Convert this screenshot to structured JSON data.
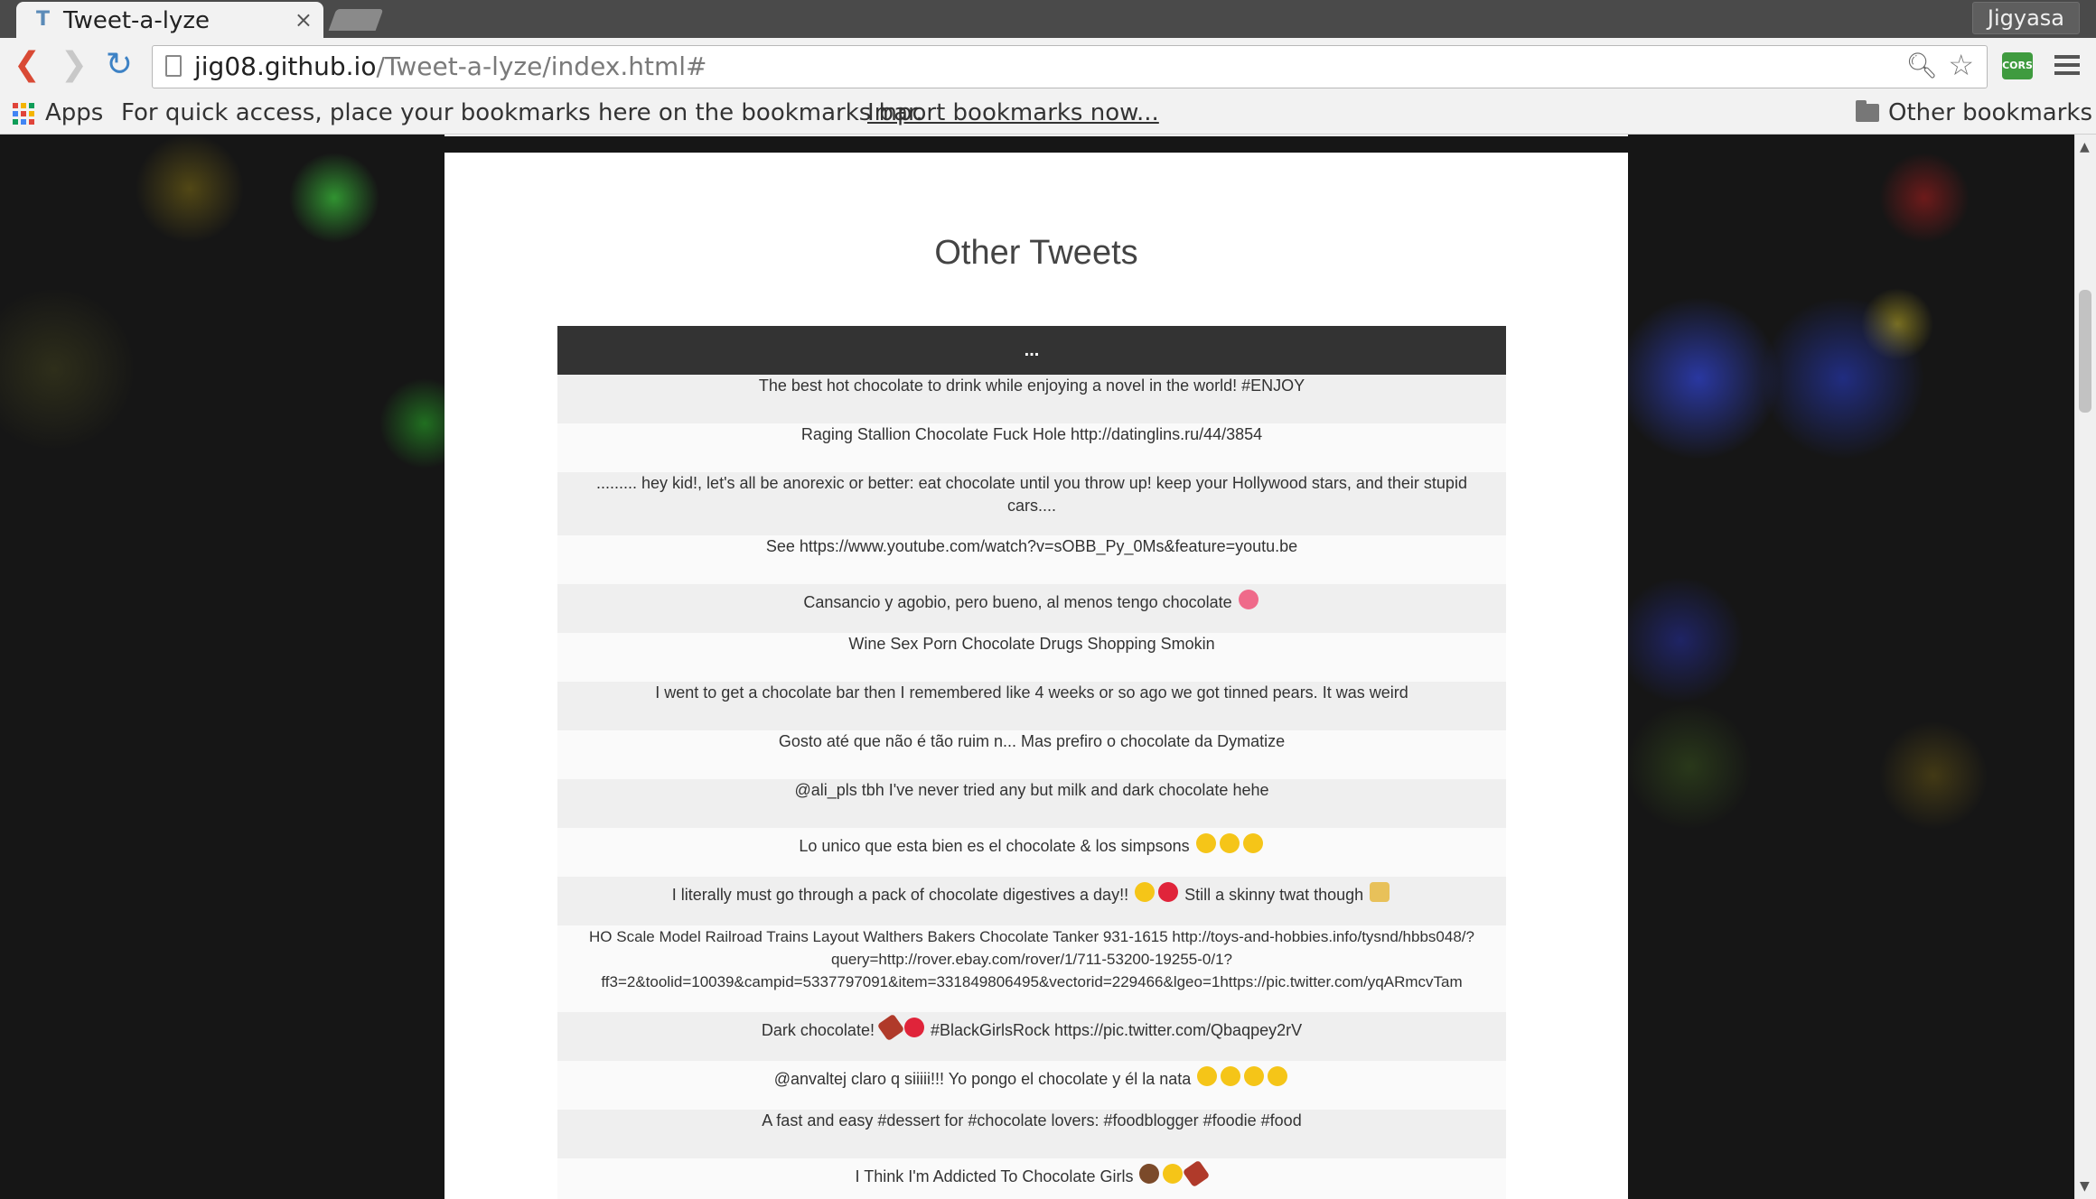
{
  "browser": {
    "tab_title": "Tweet-a-lyze",
    "tab_close": "×",
    "profile_name": "Jigyasa",
    "url_host": "jig08.github.io",
    "url_path": "/Tweet-a-lyze/index.html#",
    "extension_label": "CORS"
  },
  "bookmarks_bar": {
    "apps_label": "Apps",
    "hint": "For quick access, place your bookmarks here on the bookmarks bar.",
    "import_link": "Import bookmarks now...",
    "other_bookmarks": "Other bookmarks"
  },
  "page": {
    "heading": "Other Tweets",
    "table_header": "...",
    "tweets": [
      {
        "text": "The best hot chocolate to drink while enjoying a novel in the world! #ENJOY",
        "emoji": []
      },
      {
        "text": "Raging Stallion Chocolate Fuck Hole http://datinglins.ru/44/3854",
        "emoji": []
      },
      {
        "text": "......... hey kid!, let's all be anorexic or better: eat chocolate until you throw up! keep your Hollywood stars, and their stupid cars....",
        "emoji": []
      },
      {
        "text": "See https://www.youtube.com/watch?v=sOBB_Py_0Ms&feature=youtu.be",
        "emoji": []
      },
      {
        "text": "Cansancio y agobio, pero bueno, al menos tengo chocolate",
        "emoji": [
          "pink"
        ]
      },
      {
        "text": "Wine Sex Porn Chocolate Drugs Shopping Smokin",
        "emoji": []
      },
      {
        "text": "I went to get a chocolate bar then I remembered like 4 weeks or so ago we got tinned pears. It was weird",
        "emoji": []
      },
      {
        "text": "Gosto até que não é tão ruim n... Mas prefiro o chocolate da Dymatize",
        "emoji": []
      },
      {
        "text": "@ali_pls tbh I've never tried any but milk and dark chocolate hehe",
        "emoji": []
      },
      {
        "text": "Lo unico que esta bien es el chocolate & los simpsons",
        "emoji": [
          "yellow",
          "yellow",
          "yellow"
        ]
      },
      {
        "text": "I literally must go through a pack of chocolate digestives a day!!",
        "emoji": [
          "yellow",
          "red"
        ],
        "text_after": "Still a skinny twat though",
        "emoji_after": [
          "blonde"
        ]
      },
      {
        "text": "HO Scale Model Railroad Trains Layout Walthers Bakers Chocolate Tanker 931-1615 http://toys-and-hobbies.info/tysnd/hbbs048/?query=http://rover.ebay.com/rover/1/711-53200-19255-0/1?ff3=2&toolid=10039&campid=5337797091&item=331849806495&vectorid=229466&lgeo=1https://pic.twitter.com/yqARmcvTam",
        "emoji": []
      },
      {
        "text": "Dark chocolate!",
        "emoji": [
          "choc",
          "red"
        ],
        "text_after": "#BlackGirlsRock https://pic.twitter.com/Qbaqpey2rV",
        "emoji_after": []
      },
      {
        "text": "@anvaltej claro q siiiii!!! Yo pongo el chocolate y él la nata",
        "emoji": [
          "yellow",
          "yellow",
          "yellow",
          "yellow"
        ]
      },
      {
        "text": "A fast and easy #dessert for #chocolate lovers: #foodblogger #foodie #food",
        "emoji": []
      },
      {
        "text": "I Think I'm Addicted To Chocolate Girls",
        "emoji": [
          "brown",
          "yellow",
          "choc"
        ]
      }
    ]
  }
}
